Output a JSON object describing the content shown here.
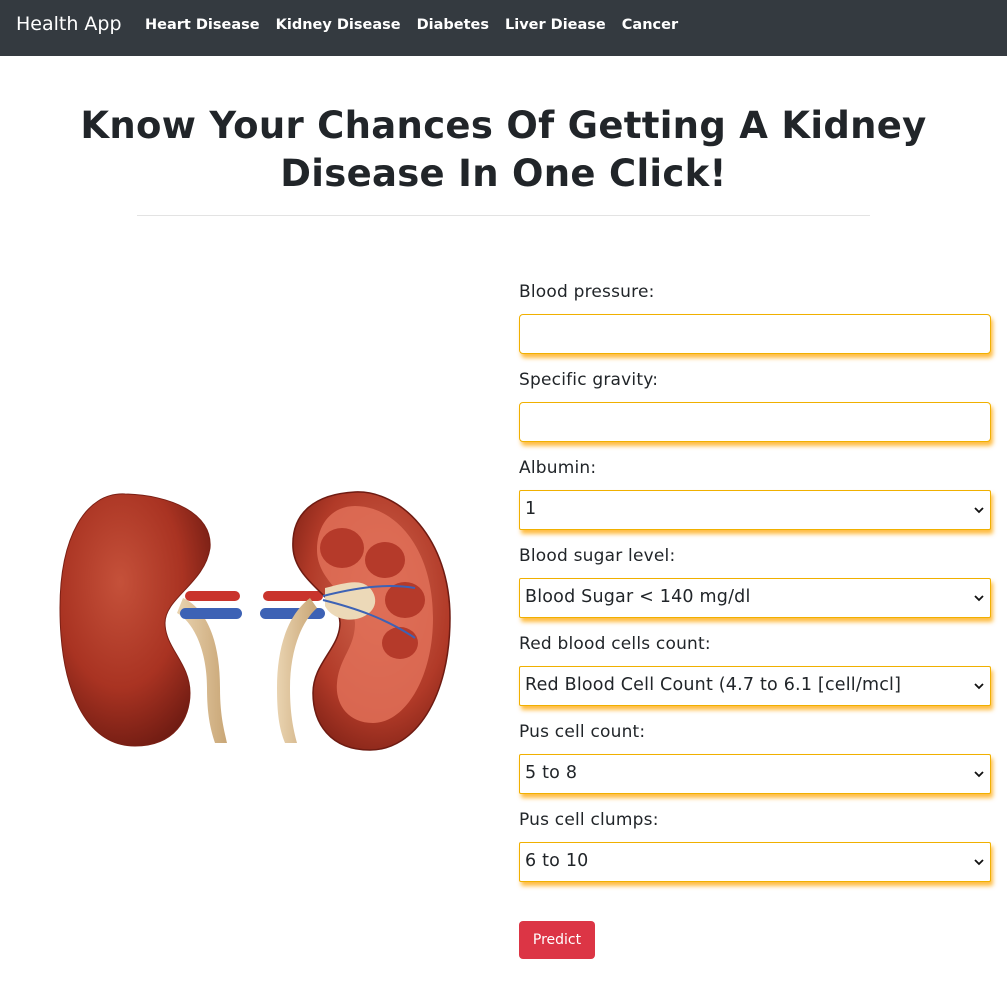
{
  "navbar": {
    "brand": "Health App",
    "links": [
      "Heart Disease",
      "Kidney Disease",
      "Diabetes",
      "Liver Diease",
      "Cancer"
    ]
  },
  "hero": {
    "title": "Know Your Chances Of Getting A Kidney Disease In One Click!"
  },
  "form": {
    "fields": [
      {
        "label": "Blood pressure:",
        "type": "input",
        "value": ""
      },
      {
        "label": "Specific gravity:",
        "type": "input",
        "value": ""
      },
      {
        "label": "Albumin:",
        "type": "select",
        "value": "1"
      },
      {
        "label": "Blood sugar level:",
        "type": "select",
        "value": "Blood Sugar < 140 mg/dl"
      },
      {
        "label": "Red blood cells count:",
        "type": "select",
        "value": "Red Blood Cell Count (4.7 to 6.1 [cell/mcl]"
      },
      {
        "label": "Pus cell count:",
        "type": "select",
        "value": "5 to 8"
      },
      {
        "label": "Pus cell clumps:",
        "type": "select",
        "value": "6 to 10"
      }
    ],
    "submit_label": "Predict"
  },
  "colors": {
    "navbar": "#343a40",
    "field_border": "#f0b000",
    "field_shadow": "#ffa500",
    "predict": "#dc3545"
  },
  "icons": {
    "select_arrow": "chevron-down-icon",
    "illustration": "kidney-illustration"
  }
}
